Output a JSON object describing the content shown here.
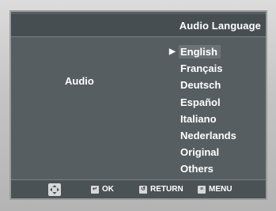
{
  "menu": {
    "title": "Audio Language",
    "section_label": "Audio",
    "options": [
      {
        "label": "English",
        "selected": true
      },
      {
        "label": "Français",
        "selected": false
      },
      {
        "label": "Deutsch",
        "selected": false
      },
      {
        "label": "Español",
        "selected": false
      },
      {
        "label": "Italiano",
        "selected": false
      },
      {
        "label": "Nederlands",
        "selected": false
      },
      {
        "label": "Original",
        "selected": false
      },
      {
        "label": "Others",
        "selected": false
      }
    ],
    "selection_indicator": "▶"
  },
  "footer": {
    "navigate_icon": "dpad-icon",
    "ok_label": "OK",
    "ok_icon": "enter-icon",
    "return_label": "RETURN",
    "return_icon": "return-icon",
    "menu_label": "MENU",
    "menu_icon": "menu-icon"
  },
  "colors": {
    "screen_bg": "#575e61",
    "title_bar_bg": "#474e51",
    "highlight_bg": "#6c7376",
    "text": "#ffffff"
  }
}
